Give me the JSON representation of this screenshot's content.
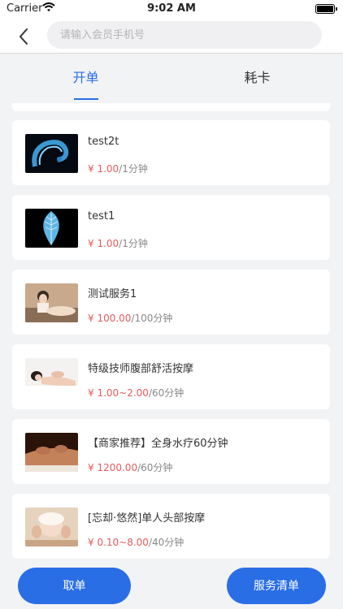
{
  "status_bar": {
    "carrier": "Carrier",
    "time": "9:02 AM"
  },
  "nav": {
    "search_placeholder": "请输入会员手机号"
  },
  "tabs": [
    {
      "label": "开单",
      "active": true
    },
    {
      "label": "耗卡",
      "active": false
    }
  ],
  "services": [
    {
      "name": "test2t",
      "price": "¥ 1.00",
      "duration": "/1分钟",
      "image": "blue-swirl"
    },
    {
      "name": "test1",
      "price": "¥ 1.00",
      "duration": "/1分钟",
      "image": "blue-leaf"
    },
    {
      "name": "测试服务1",
      "price": "¥ 100.00",
      "duration": "/100分钟",
      "image": "spa-photo"
    },
    {
      "name": "特级技师腹部舒活按摩",
      "price": "¥ 1.00~2.00",
      "duration": "/60分钟",
      "image": "massage-photo"
    },
    {
      "name": "【商家推荐】全身水疗60分钟",
      "price": "¥ 1200.00",
      "duration": "/60分钟",
      "image": "back-massage-photo"
    },
    {
      "name": "[忘却·悠然]单人头部按摩",
      "price": "¥ 0.10~8.00",
      "duration": "/40分钟",
      "image": "head-massage-photo"
    }
  ],
  "bottom": {
    "left_button": "取单",
    "right_button": "服务清单"
  },
  "colors": {
    "accent": "#2a6ee6",
    "price": "#e45c5c"
  }
}
